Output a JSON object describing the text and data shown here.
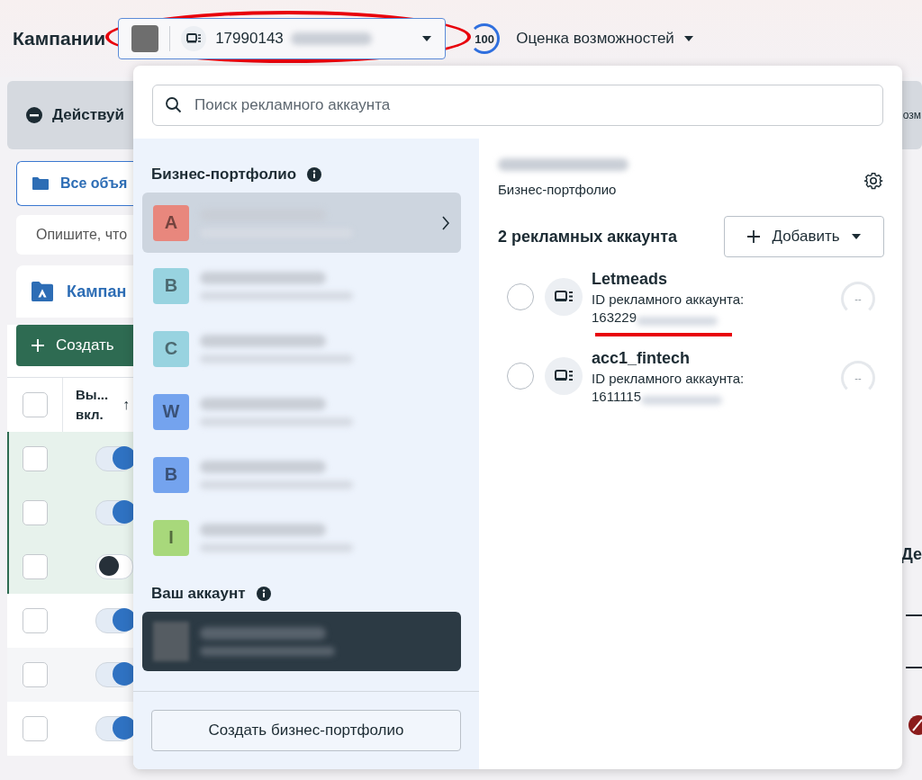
{
  "header": {
    "title": "Кампании",
    "account_id": "17990143",
    "score": "100",
    "opportunity_label": "Оценка возможностей"
  },
  "background": {
    "action_button": "Действуй",
    "right_fragment": "озм",
    "all_objects_tab": "Все объя",
    "describe_field": "Опишите, что",
    "campaigns_tab": "Кампан",
    "create_button": "Создать",
    "header_checked": false,
    "column_header": "Вы... вкл.",
    "sort_arrow": "↑",
    "column_fragment": "Де",
    "rows": [
      {
        "checked": false,
        "on": true,
        "highlighted": true
      },
      {
        "checked": false,
        "on": true,
        "highlighted": true
      },
      {
        "checked": false,
        "on": false,
        "highlighted": true
      },
      {
        "checked": false,
        "on": true,
        "highlighted": false
      },
      {
        "checked": false,
        "on": true,
        "highlighted": false
      },
      {
        "checked": false,
        "on": true,
        "highlighted": false
      }
    ]
  },
  "dropdown": {
    "search": {
      "placeholder": "Поиск рекламного аккаунта"
    },
    "portfolio_heading": "Бизнес-портфолио",
    "portfolios": [
      {
        "letter": "A",
        "color": "#e8877d",
        "selected": true
      },
      {
        "letter": "B",
        "color": "#98d3e0",
        "selected": false
      },
      {
        "letter": "C",
        "color": "#98d3e0",
        "selected": false
      },
      {
        "letter": "W",
        "color": "#74a3ee",
        "selected": false
      },
      {
        "letter": "B",
        "color": "#74a3ee",
        "selected": false
      },
      {
        "letter": "I",
        "color": "#a8d87b",
        "selected": false
      }
    ],
    "your_account_heading": "Ваш аккаунт",
    "create_portfolio_button": "Создать бизнес-портфолио",
    "detail": {
      "subtitle": "Бизнес-портфолио",
      "count_label": "2 рекламных аккаунта",
      "add_button": "Добавить",
      "accounts": [
        {
          "name": "Letmeads",
          "id_label": "ID рекламного аккаунта:",
          "id": "163229",
          "score": "--",
          "selected": false,
          "underlined": true
        },
        {
          "name": "acc1_fintech",
          "id_label": "ID рекламного аккаунта:",
          "id": "1611115",
          "score": "--",
          "selected": false,
          "underlined": false
        }
      ]
    }
  }
}
